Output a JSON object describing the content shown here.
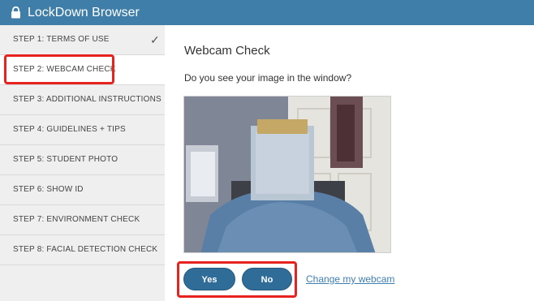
{
  "app": {
    "title": "LockDown Browser"
  },
  "sidebar": {
    "steps": [
      {
        "label": "STEP 1: TERMS OF USE",
        "completed": true
      },
      {
        "label": "STEP 2: WEBCAM CHECK",
        "active": true
      },
      {
        "label": "STEP 3: ADDITIONAL INSTRUCTIONS"
      },
      {
        "label": "STEP 4: GUIDELINES + TIPS"
      },
      {
        "label": "STEP 5: STUDENT PHOTO"
      },
      {
        "label": "STEP 6: SHOW ID"
      },
      {
        "label": "STEP 7: ENVIRONMENT CHECK"
      },
      {
        "label": "STEP 8: FACIAL DETECTION CHECK"
      }
    ]
  },
  "main": {
    "title": "Webcam Check",
    "question": "Do you see your image in the window?",
    "yes_label": "Yes",
    "no_label": "No",
    "change_webcam_label": "Change my webcam"
  },
  "colors": {
    "titlebar": "#3f7ea8",
    "button": "#2f6d98",
    "highlight": "#e8231f",
    "link": "#3d7fb0"
  },
  "icons": {
    "title": "lock-icon",
    "completed": "checkmark-icon"
  }
}
